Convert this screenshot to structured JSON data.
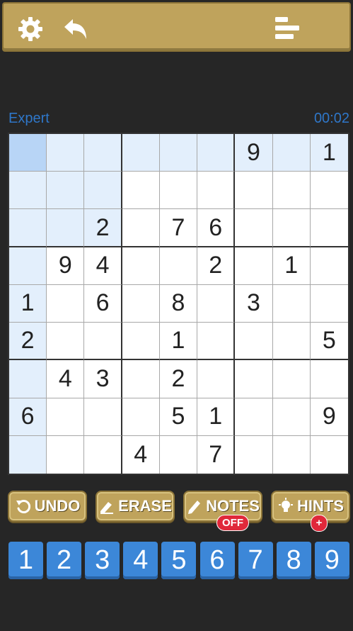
{
  "header": {
    "settings_icon": "gear-icon",
    "back_icon": "back-arrow-icon",
    "menu_icon": "bars-icon"
  },
  "status": {
    "difficulty": "Expert",
    "timer": "00:02"
  },
  "board": {
    "rows": [
      [
        "",
        "",
        "",
        "",
        "",
        "",
        "9",
        "",
        "1"
      ],
      [
        "",
        "",
        "",
        "",
        "",
        "",
        "",
        "",
        ""
      ],
      [
        "",
        "",
        "2",
        "",
        "7",
        "6",
        "",
        "",
        ""
      ],
      [
        "",
        "9",
        "4",
        "",
        "",
        "2",
        "",
        "1",
        ""
      ],
      [
        "1",
        "",
        "6",
        "",
        "8",
        "",
        "3",
        "",
        ""
      ],
      [
        "2",
        "",
        "",
        "",
        "1",
        "",
        "",
        "",
        "5"
      ],
      [
        "",
        "4",
        "3",
        "",
        "2",
        "",
        "",
        "",
        ""
      ],
      [
        "6",
        "",
        "",
        "",
        "5",
        "1",
        "",
        "",
        "9"
      ],
      [
        "",
        "",
        "",
        "4",
        "",
        "7",
        "",
        "",
        ""
      ]
    ],
    "selected_cell": [
      0,
      0
    ]
  },
  "tools": {
    "undo_label": "UNDO",
    "erase_label": "ERASE",
    "notes_label": "NOTES",
    "notes_state": "OFF",
    "hints_label": "HINTS",
    "hints_badge": "+"
  },
  "numpad": [
    "1",
    "2",
    "3",
    "4",
    "5",
    "6",
    "7",
    "8",
    "9"
  ],
  "colors": {
    "accent_gold": "#bfa35c",
    "accent_blue": "#3c87d8",
    "highlight": "#e3effc",
    "selected": "#b8d5f6",
    "badge_red": "#e0283a"
  }
}
